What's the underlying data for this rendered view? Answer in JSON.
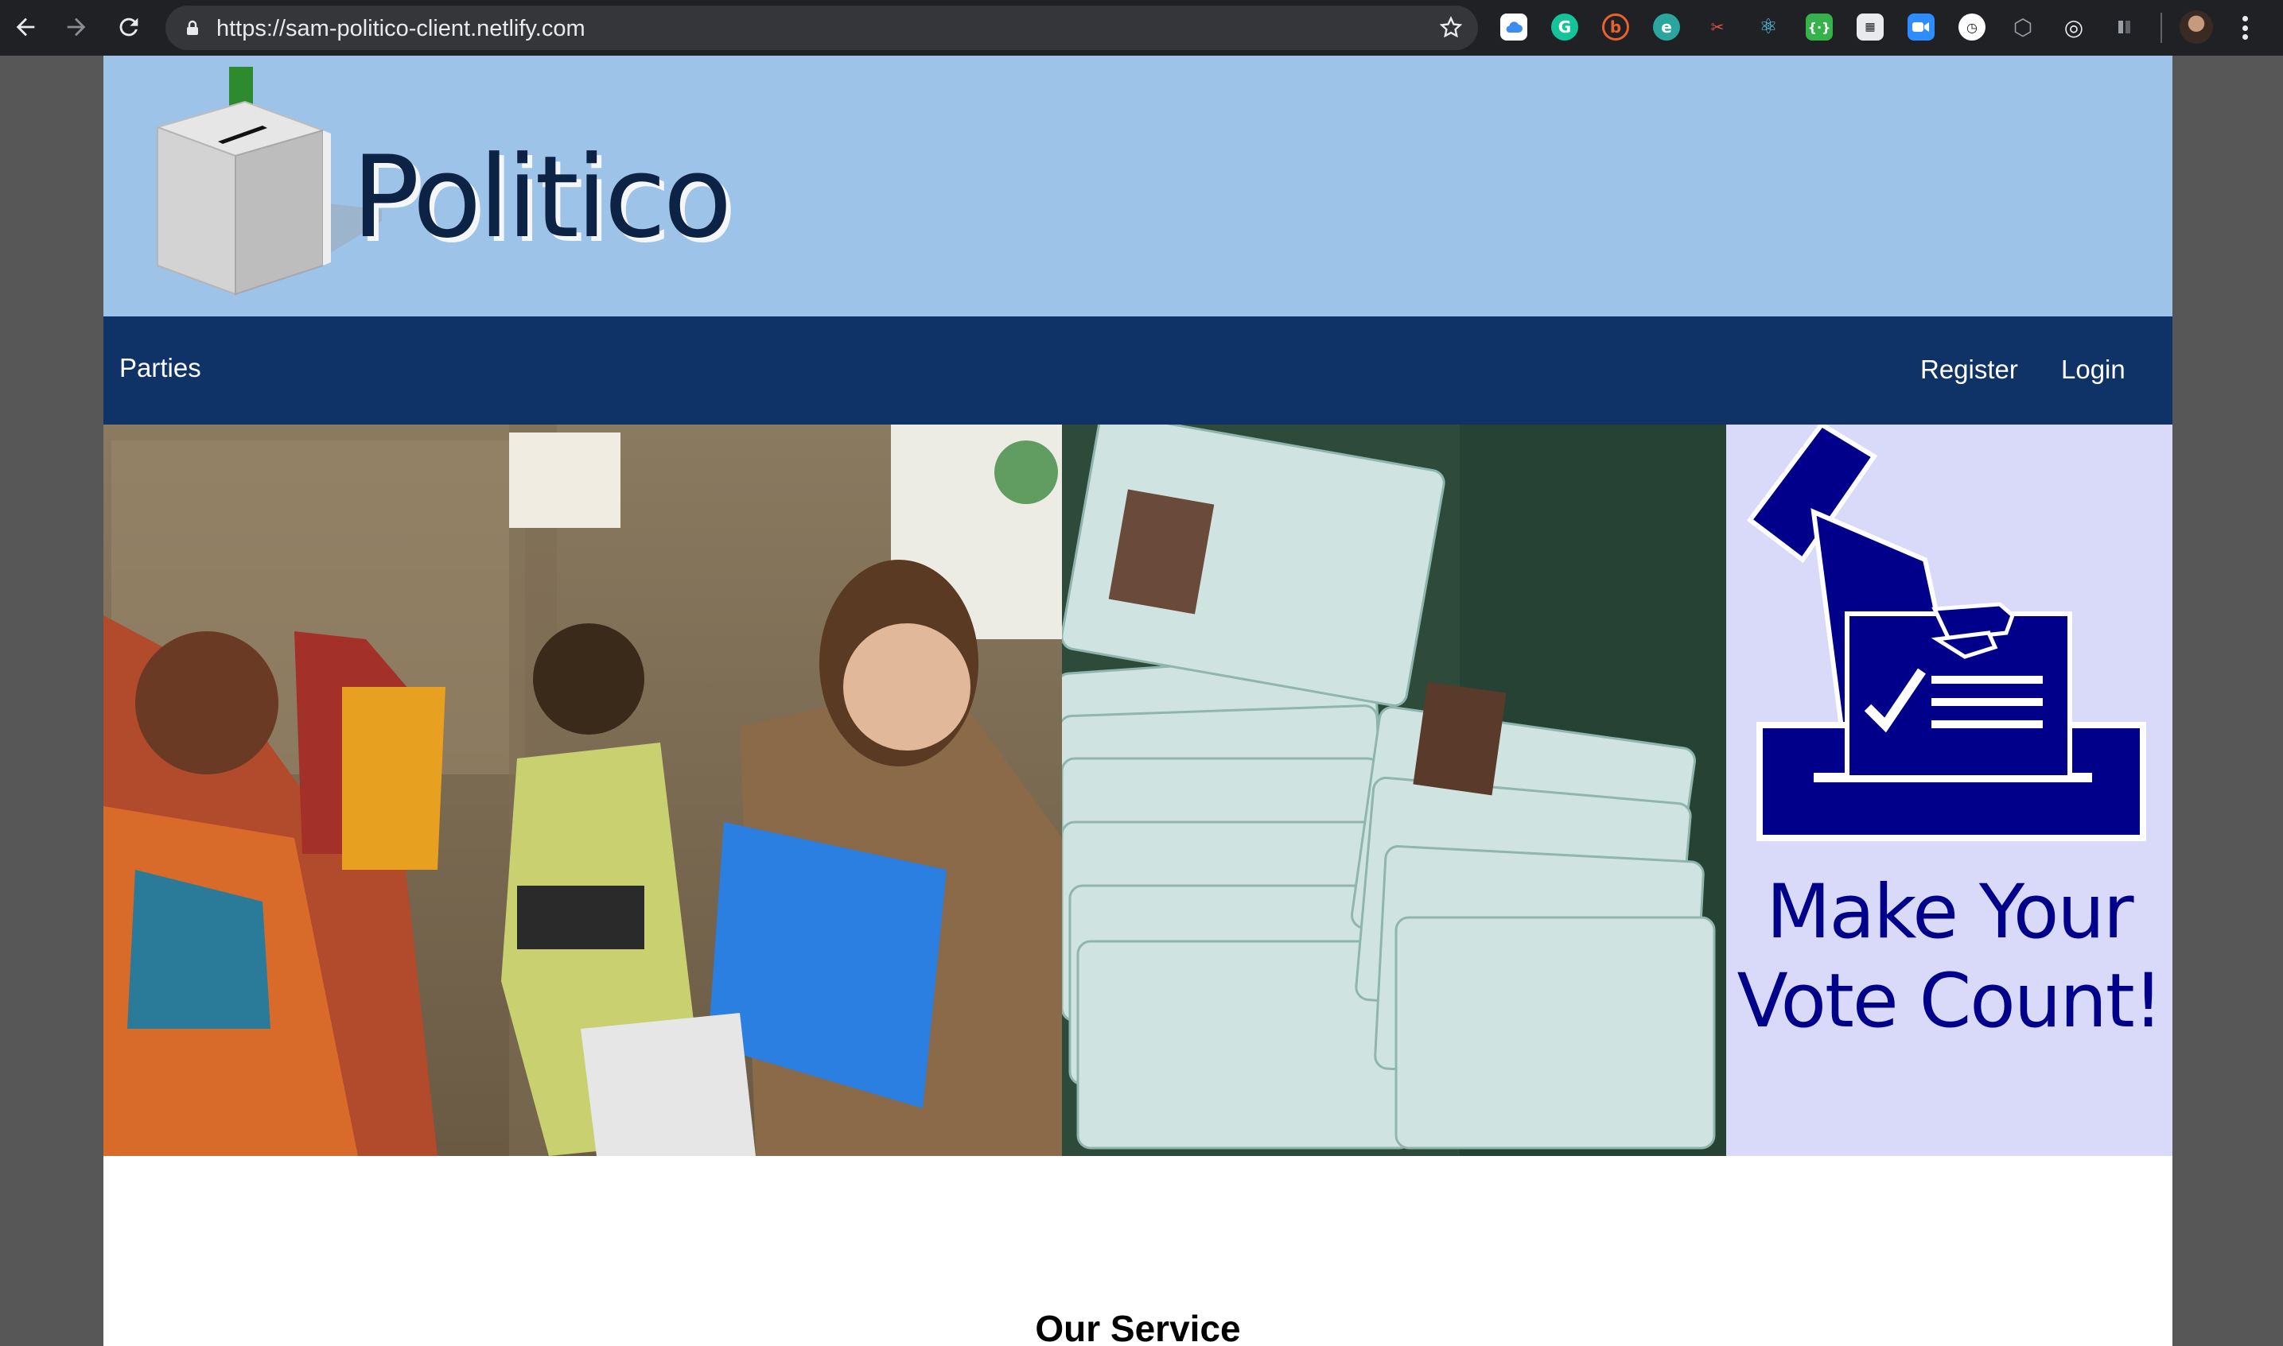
{
  "browser": {
    "url": "https://sam-politico-client.netlify.com",
    "extensions": [
      "cloud-icon",
      "grammarly-icon",
      "b-icon",
      "edge-icon",
      "scissors-icon",
      "react-icon",
      "code-icon",
      "calendar-icon",
      "zoom-icon",
      "timer-icon",
      "hexagon-icon",
      "target-icon",
      "bar-icon"
    ]
  },
  "header": {
    "brand": "Politico"
  },
  "nav": {
    "parties": "Parties",
    "register": "Register",
    "login": "Login"
  },
  "hero": {
    "slogan_line1": "Make Your",
    "slogan_line2": "Vote Count!"
  },
  "main": {
    "section_title": "Our Service"
  }
}
